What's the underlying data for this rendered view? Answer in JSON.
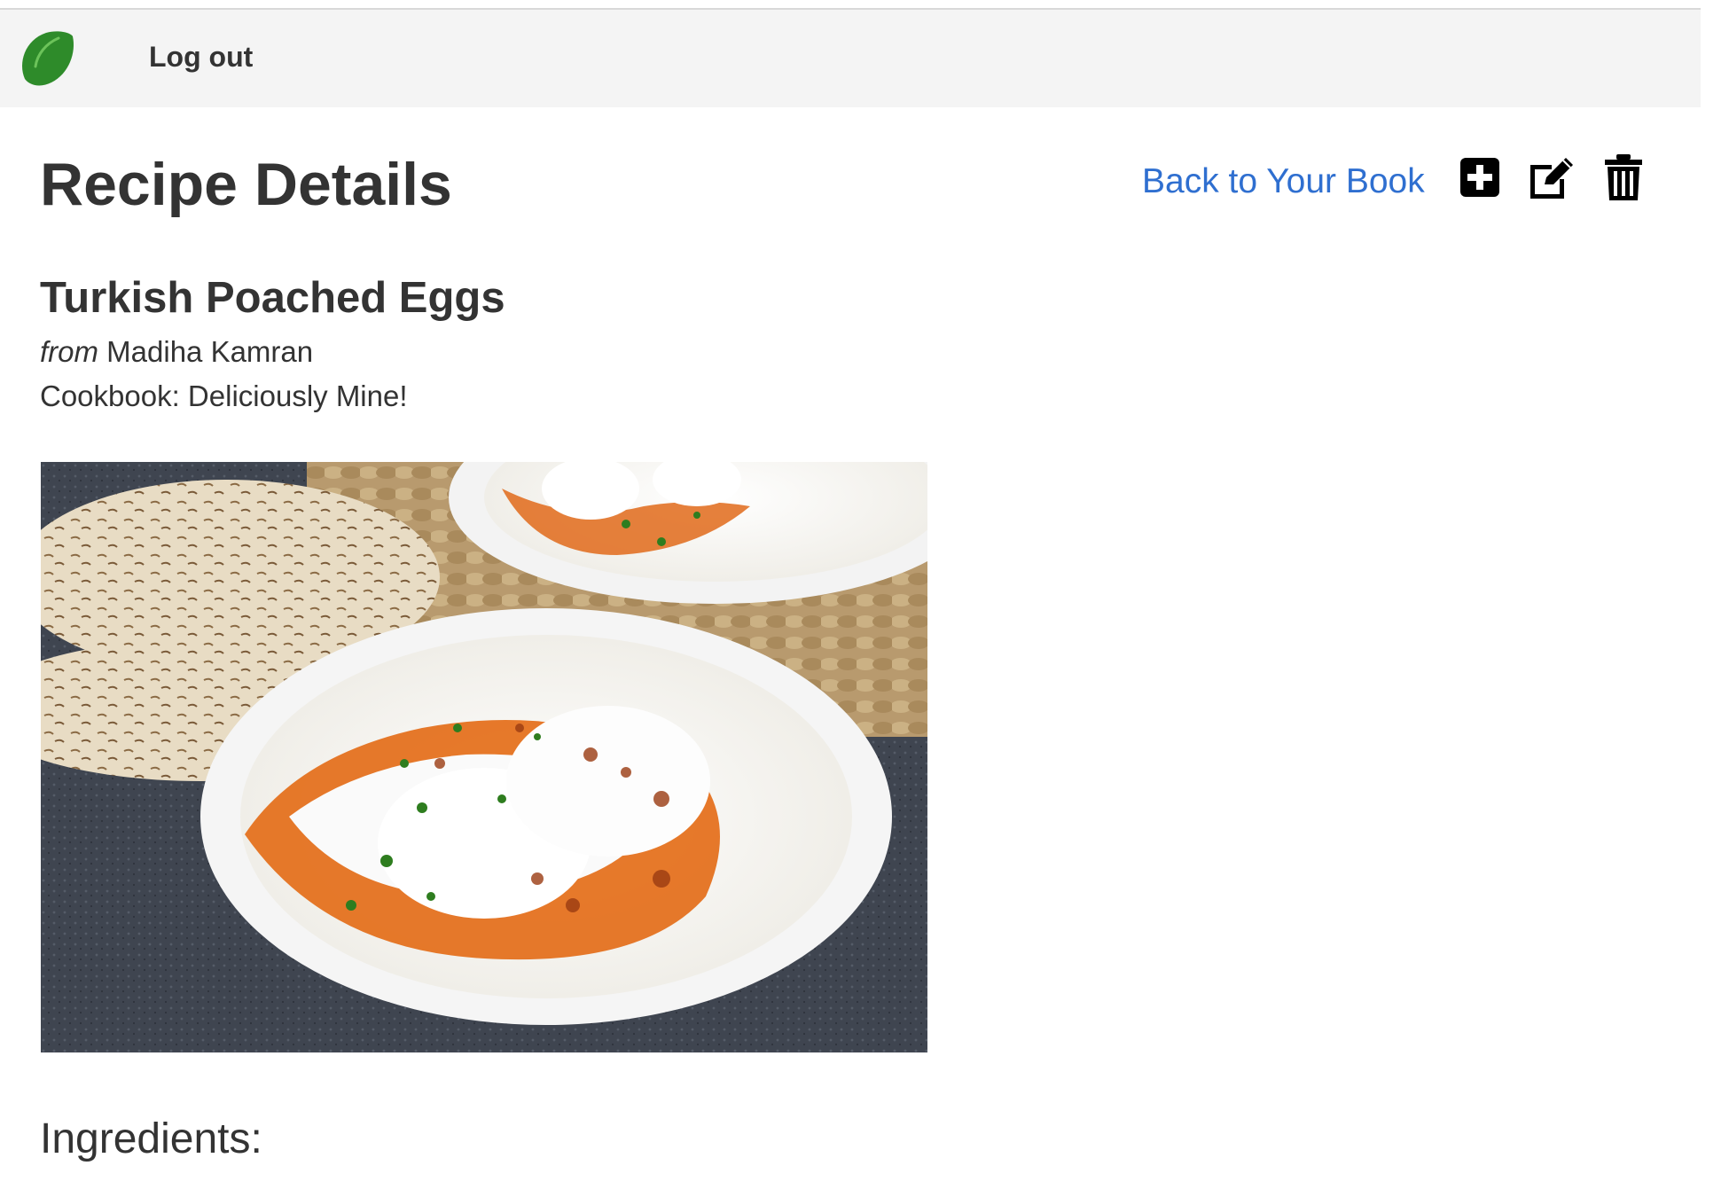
{
  "nav": {
    "logo_icon": "lime-leaf-icon",
    "logout_label": "Log out"
  },
  "header": {
    "title": "Recipe Details",
    "back_link": "Back to Your Book",
    "actions": [
      {
        "name": "add",
        "icon": "plus-square-icon"
      },
      {
        "name": "edit",
        "icon": "edit-icon"
      },
      {
        "name": "delete",
        "icon": "trash-icon"
      }
    ]
  },
  "recipe": {
    "title": "Turkish Poached Eggs",
    "from_label": "from",
    "author": "Madiha Kamran",
    "cookbook_line": "Cookbook: Deliciously Mine!",
    "ingredients_heading": "Ingredients:"
  },
  "colors": {
    "nav_bg": "#f4f4f4",
    "link": "#2f6fd0",
    "logo_green": "#2e8b2a",
    "text": "#333333"
  }
}
